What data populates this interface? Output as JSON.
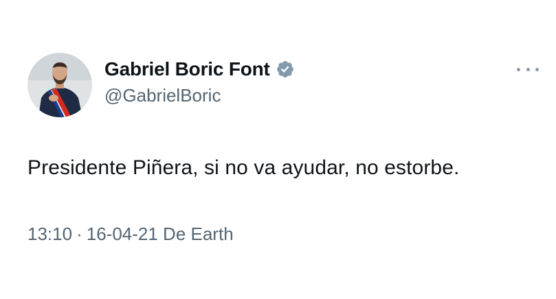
{
  "author": {
    "display_name": "Gabriel Boric Font",
    "handle": "@GabrielBoric",
    "verified_icon": "verified-badge-icon",
    "avatar": "profile-photo"
  },
  "tweet": {
    "text": "Presidente Piñera, si no va ayudar, no estorbe.",
    "time": "13:10",
    "separator": "·",
    "date_source": "16-04-21 De Earth"
  },
  "colors": {
    "text": "#0f1419",
    "secondary": "#536471",
    "badge": "#829aab",
    "background": "#ffffff"
  },
  "icons": {
    "more": "more-options-icon"
  }
}
